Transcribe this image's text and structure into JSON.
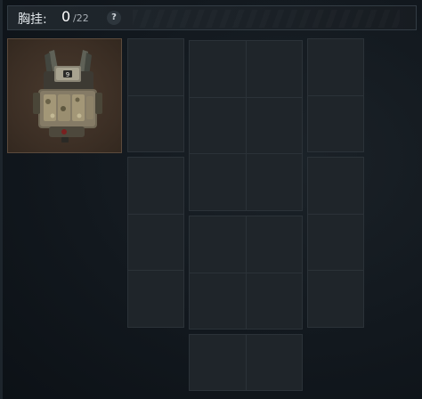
{
  "header": {
    "label": "胸挂:",
    "count": "0",
    "capacity": "/22",
    "help_glyph": "?"
  },
  "equipped_item": {
    "icon": "chest-rig-icon",
    "badge": "9"
  },
  "grids": [
    {
      "name": "grid-left-top",
      "cols": 1,
      "rows": 2
    },
    {
      "name": "grid-left-bottom",
      "cols": 1,
      "rows": 3
    },
    {
      "name": "grid-center-top",
      "cols": 2,
      "rows": 3
    },
    {
      "name": "grid-center-middle",
      "cols": 2,
      "rows": 2
    },
    {
      "name": "grid-center-bottom",
      "cols": 2,
      "rows": 1
    },
    {
      "name": "grid-right-top",
      "cols": 1,
      "rows": 2
    },
    {
      "name": "grid-right-bottom",
      "cols": 1,
      "rows": 3
    }
  ],
  "colors": {
    "background": "#12181e",
    "slot_border": "#4b545b",
    "item_background": "#3b2e24"
  }
}
